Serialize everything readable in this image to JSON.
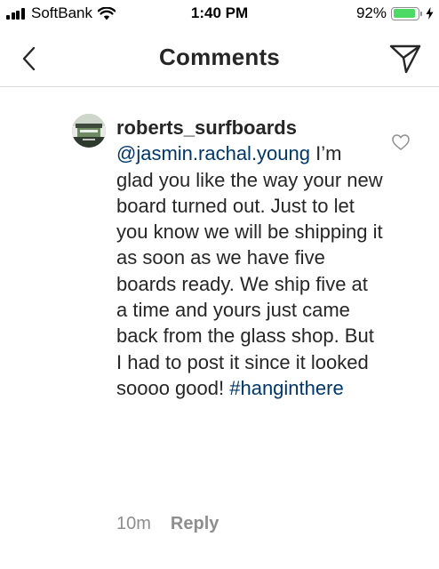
{
  "status_bar": {
    "carrier": "SoftBank",
    "time": "1:40 PM",
    "battery_percent": "92%",
    "battery_level": 0.92,
    "battery_color": "#4cd964"
  },
  "header": {
    "title": "Comments",
    "back_icon": "chevron-left-icon",
    "action_icon": "paper-plane-icon"
  },
  "comment": {
    "username": "roberts_surfboards",
    "mention": "@jasmin.rachal.young",
    "text": "I’m glad you like the way your new board turned out.  Just to let you know we will be shipping it as soon as we have five boards ready. We ship five at a time and yours just came back from the glass shop. But I had to post it since it looked soooo good!",
    "hashtag": "#hanginthere",
    "time_ago": "10m",
    "reply_label": "Reply",
    "like_icon": "heart-outline-icon",
    "link_color": "#00376b"
  }
}
